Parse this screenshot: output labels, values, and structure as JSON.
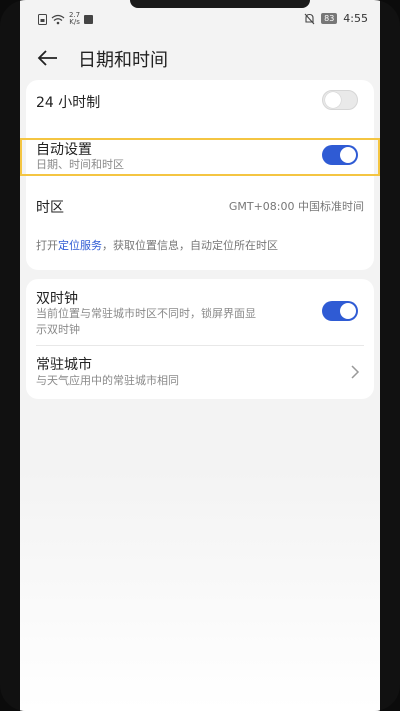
{
  "status_bar": {
    "speed_value": "2.7",
    "speed_unit": "K/s",
    "battery": "83",
    "time": "4:55"
  },
  "header": {
    "title": "日期和时间"
  },
  "settings": {
    "hour24": {
      "label": "24 小时制",
      "enabled": false
    },
    "auto_set": {
      "label": "自动设置",
      "sub": "日期、时间和时区",
      "enabled": true
    },
    "timezone": {
      "label": "时区",
      "value": "GMT+08:00 中国标准时间"
    },
    "location_hint": {
      "prefix": "打开",
      "link": "定位服务",
      "suffix": "，获取位置信息，自动定位所在时区"
    },
    "dual_clock": {
      "label": "双时钟",
      "sub_line1": "当前位置与常驻城市时区不同时，锁屏界面显",
      "sub_line2": "示双时钟",
      "enabled": true
    },
    "home_city": {
      "label": "常驻城市",
      "sub": "与天气应用中的常驻城市相同"
    }
  },
  "colors": {
    "accent": "#2f5bd4",
    "highlight": "#f4c542"
  }
}
